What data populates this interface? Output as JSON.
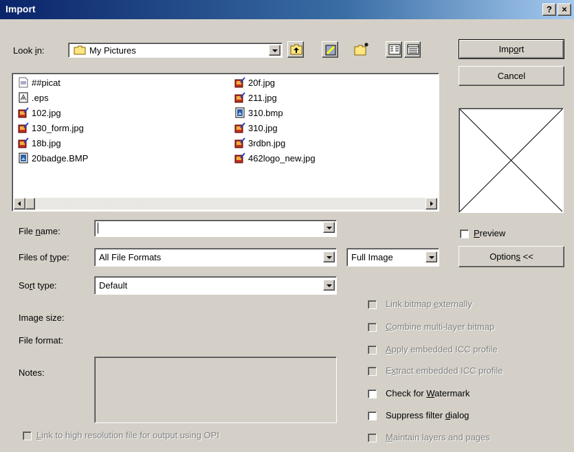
{
  "window": {
    "title": "Import",
    "help_label": "?",
    "close_label": "×"
  },
  "lookin": {
    "label_pre": "Look ",
    "label_ul": "i",
    "label_post": "n:",
    "folder": "My Pictures"
  },
  "files": {
    "col1": [
      {
        "name": "##picat",
        "icon": "generic-file-icon"
      },
      {
        "name": ".eps",
        "icon": "eps-file-icon"
      },
      {
        "name": "102.jpg",
        "icon": "jpg-file-icon"
      },
      {
        "name": "130_form.jpg",
        "icon": "jpg-file-icon"
      },
      {
        "name": "18b.jpg",
        "icon": "jpg-file-icon"
      },
      {
        "name": "20badge.BMP",
        "icon": "bmp-file-icon"
      }
    ],
    "col2": [
      {
        "name": "20f.jpg",
        "icon": "jpg-file-icon"
      },
      {
        "name": "211.jpg",
        "icon": "jpg-file-icon"
      },
      {
        "name": "310.bmp",
        "icon": "bmp-file-icon"
      },
      {
        "name": "310.jpg",
        "icon": "jpg-file-icon"
      },
      {
        "name": "3rdbn.jpg",
        "icon": "jpg-file-icon"
      },
      {
        "name": "462logo_new.jpg",
        "icon": "jpg-file-icon"
      }
    ]
  },
  "buttons": {
    "import_pre": "Imp",
    "import_ul": "o",
    "import_post": "rt",
    "cancel": "Cancel",
    "options_pre": "Option",
    "options_ul": "s",
    "options_post": " <<"
  },
  "fields": {
    "file_name_pre": "File ",
    "file_name_ul": "n",
    "file_name_post": "ame:",
    "file_name_value": "",
    "files_of_type_pre": "Files of ",
    "files_of_type_ul": "t",
    "files_of_type_post": "ype:",
    "files_of_type_value": "All File Formats",
    "sort_type_pre": "So",
    "sort_type_ul": "r",
    "sort_type_post": "t type:",
    "sort_type_value": "Default",
    "image_mode_value": "Full Image",
    "image_size": "Image size:",
    "file_format": "File format:",
    "notes": "Notes:"
  },
  "preview": {
    "pre": "",
    "ul": "P",
    "post": "review",
    "checked": false
  },
  "options": [
    {
      "pre": "Link bitmap ",
      "ul": "e",
      "post": "xternally",
      "enabled": false,
      "checked": false
    },
    {
      "pre": "",
      "ul": "C",
      "post": "ombine multi-layer bitmap",
      "enabled": false,
      "checked": false
    },
    {
      "pre": "",
      "ul": "A",
      "post": "pply embedded ICC profile",
      "enabled": false,
      "checked": false
    },
    {
      "pre": "E",
      "ul": "x",
      "post": "tract embedded ICC profile",
      "enabled": false,
      "checked": false
    },
    {
      "pre": "Check for ",
      "ul": "W",
      "post": "atermark",
      "enabled": true,
      "checked": false
    },
    {
      "pre": "Suppress filter ",
      "ul": "d",
      "post": "ialog",
      "enabled": true,
      "checked": false
    },
    {
      "pre": "",
      "ul": "M",
      "post": "aintain layers and pages",
      "enabled": false,
      "checked": false
    }
  ],
  "opi": {
    "pre": "",
    "ul": "L",
    "post": "ink to high resolution file for output using OPI",
    "enabled": false
  },
  "colors": {
    "title_start": "#0a246a",
    "title_end": "#a6caf0",
    "face": "#d4d0c8"
  }
}
